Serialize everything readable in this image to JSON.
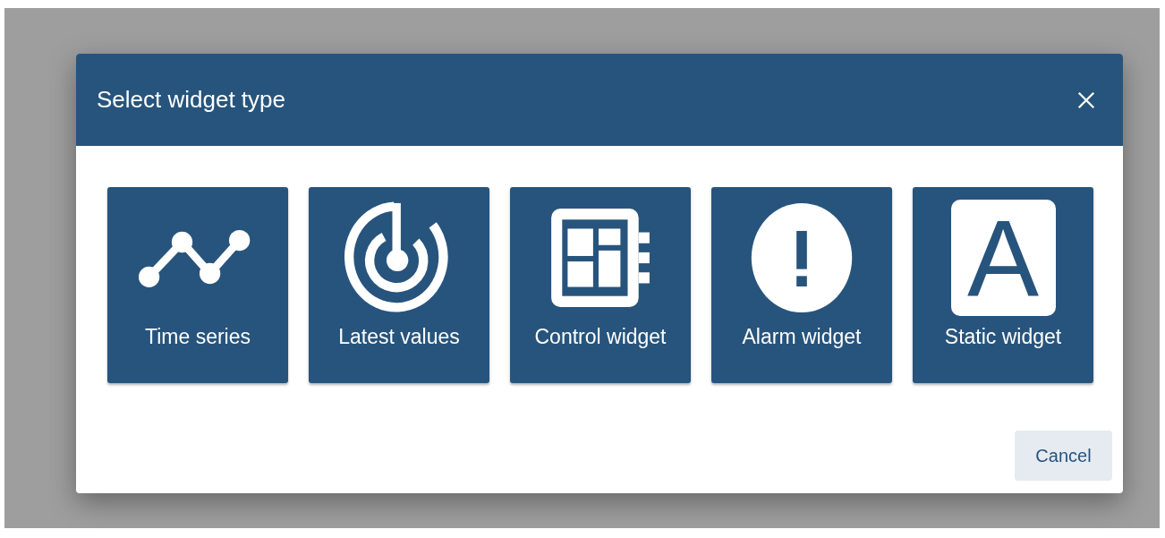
{
  "dialog": {
    "title": "Select widget type",
    "tiles": [
      {
        "kind": "time-series",
        "label": "Time series"
      },
      {
        "kind": "gauge",
        "label": "Latest values"
      },
      {
        "kind": "control",
        "label": "Control widget"
      },
      {
        "kind": "alarm",
        "label": "Alarm widget"
      },
      {
        "kind": "static",
        "label": "Static widget",
        "glyph": "A"
      }
    ],
    "buttons": [
      "Cancel"
    ]
  }
}
